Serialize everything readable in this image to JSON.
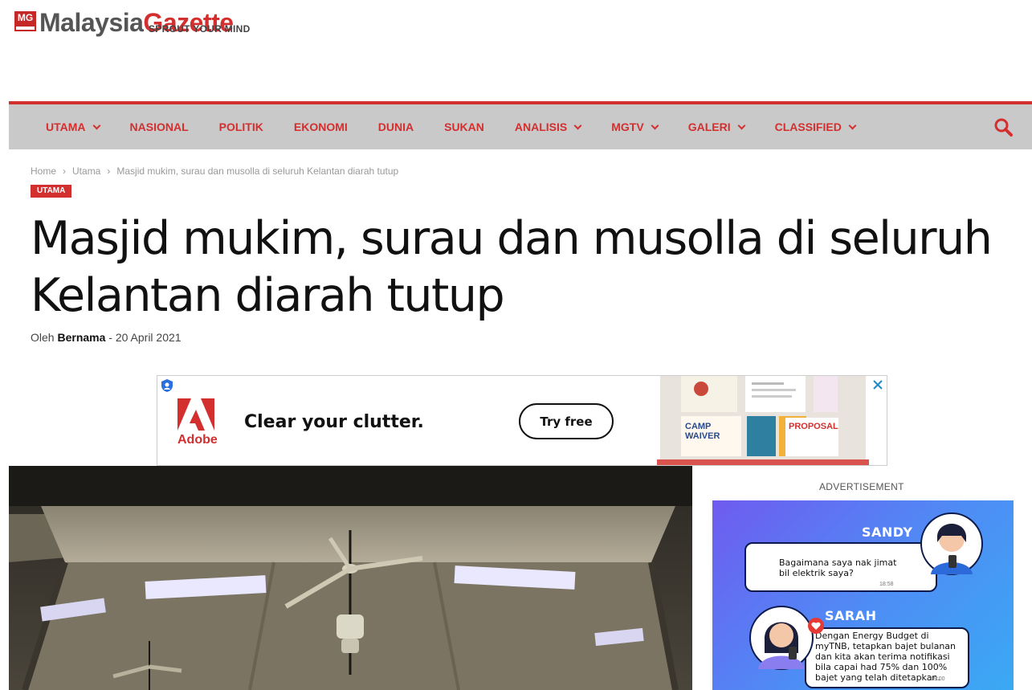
{
  "header": {
    "logo_mark": "MG",
    "logo_word1": "Malaysia",
    "logo_word2": "Gazette",
    "tagline": "SPROUT YOUR MIND"
  },
  "nav": {
    "items": [
      {
        "label": "UTAMA",
        "dropdown": true
      },
      {
        "label": "NASIONAL",
        "dropdown": false
      },
      {
        "label": "POLITIK",
        "dropdown": false
      },
      {
        "label": "EKONOMI",
        "dropdown": false
      },
      {
        "label": "DUNIA",
        "dropdown": false
      },
      {
        "label": "SUKAN",
        "dropdown": false
      },
      {
        "label": "ANALISIS",
        "dropdown": true
      },
      {
        "label": "MGTV",
        "dropdown": true
      },
      {
        "label": "GALERI",
        "dropdown": true
      },
      {
        "label": "CLASSIFIED",
        "dropdown": true
      }
    ],
    "search_icon": "search-icon",
    "accent_color": "#d32f2f",
    "bar_color": "#c9c9c9"
  },
  "breadcrumb": {
    "home": "Home",
    "category": "Utama",
    "current": "Masjid mukim, surau dan musolla di seluruh Kelantan diarah tutup"
  },
  "article": {
    "category_badge": "UTAMA",
    "title": "Masjid mukim, surau dan musolla di seluruh Kelantan diarah tutup",
    "by_prefix": "Oleh",
    "author": "Bernama",
    "date_sep": "-",
    "date": "20 April 2021"
  },
  "ad_banner": {
    "brand": "Adobe",
    "headline": "Clear your clutter.",
    "cta": "Try free",
    "art_text_1": "CAMP",
    "art_text_2": "WAIVER",
    "art_text_3": "PROPOSAL"
  },
  "sidebar_ad": {
    "label": "ADVERTISEMENT",
    "name1": "SANDY",
    "msg1": "Bagaimana saya nak jimat bil elektrik saya?",
    "time1": "18:58",
    "name2": "SARAH",
    "msg2": "Dengan Energy Budget di myTNB, tetapkan bajet bulanan dan kita akan terima notifikasi bila capai had 75% dan 100% bajet yang telah ditetapkan.",
    "time2": "19:00"
  }
}
